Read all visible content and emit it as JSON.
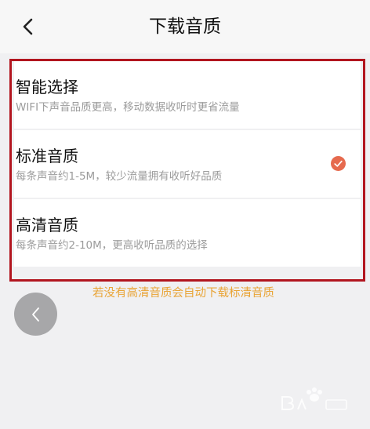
{
  "header": {
    "title": "下载音质",
    "back_icon": "chevron-left-icon"
  },
  "options": [
    {
      "title": "智能选择",
      "description": "WIFI下声音品质更高，移动数据收听时更省流量",
      "selected": false
    },
    {
      "title": "标准音质",
      "description": "每条声音约1-5M，较少流量拥有收听好品质",
      "selected": true
    },
    {
      "title": "高清音质",
      "description": "每条声音约2-10M，更高收听品质的选择",
      "selected": false
    }
  ],
  "note": "若没有高清音质会自动下载标清音质",
  "floating_back_icon": "chevron-left-icon",
  "colors": {
    "highlight_border": "#b2151f",
    "check": "#e66a4e",
    "note": "#e9a436"
  }
}
